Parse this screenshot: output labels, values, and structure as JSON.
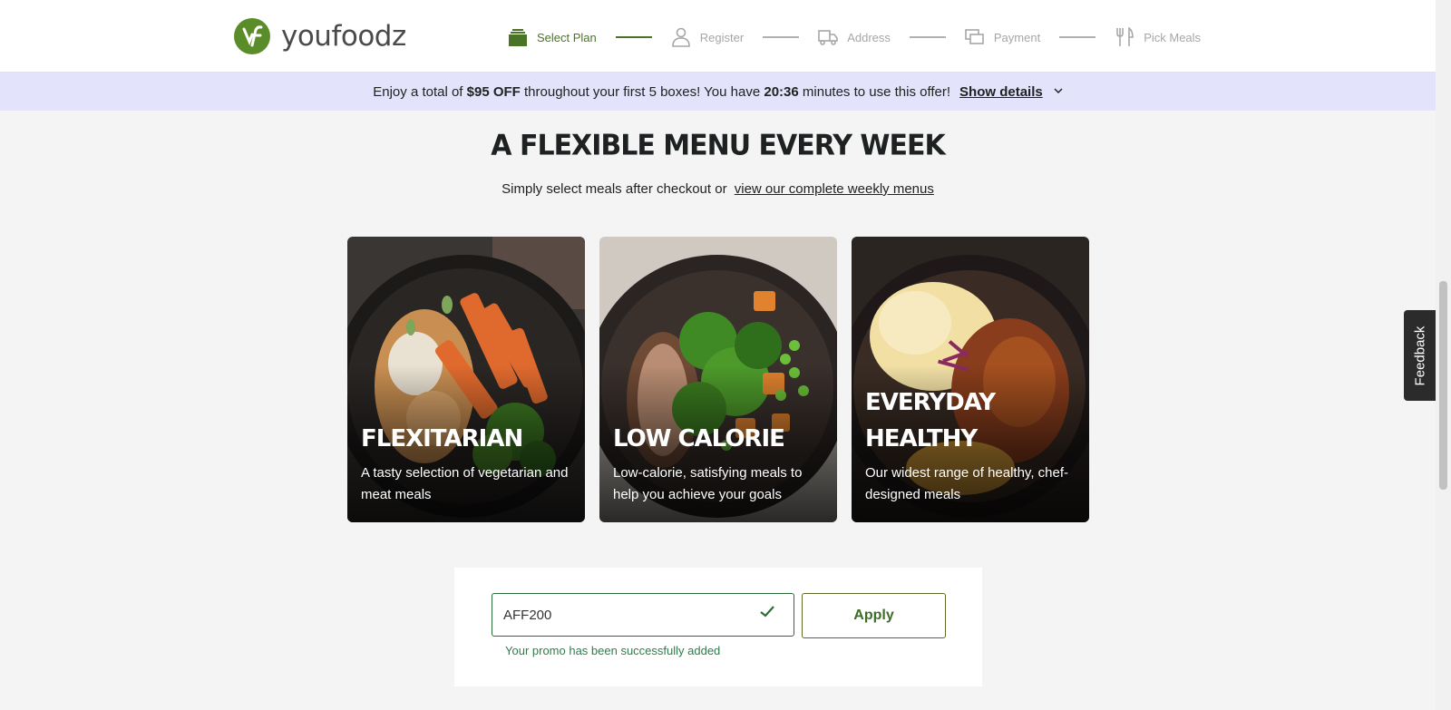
{
  "header": {
    "logo_text": "youfoodz",
    "steps": [
      {
        "label": "Select Plan",
        "icon": "box-stack-icon",
        "active": true
      },
      {
        "label": "Register",
        "icon": "person-icon",
        "active": false
      },
      {
        "label": "Address",
        "icon": "truck-icon",
        "active": false
      },
      {
        "label": "Payment",
        "icon": "card-icon",
        "active": false
      },
      {
        "label": "Pick Meals",
        "icon": "fork-knife-icon",
        "active": false
      }
    ]
  },
  "banner": {
    "text_1": "Enjoy a total of ",
    "discount": "$95 OFF",
    "text_2": " throughout your first 5 boxes! You have ",
    "timer": "20:36",
    "text_3": " minutes to use this offer!",
    "details_label": "Show details"
  },
  "menu": {
    "title": "A FLEXIBLE MENU EVERY WEEK",
    "subtitle": "Simply select meals after checkout or",
    "link_label": "view our complete weekly menus",
    "cards": [
      {
        "title": "FLEXITARIAN",
        "desc": "A tasty selection of vegetarian and meat meals"
      },
      {
        "title": "LOW CALORIE",
        "desc": "Low-calorie, satisfying meals to help you achieve your goals"
      },
      {
        "title": "EVERYDAY HEALTHY",
        "desc": "Our widest range of healthy, chef-designed meals"
      }
    ]
  },
  "promo": {
    "code_value": "AFF200",
    "apply_label": "Apply",
    "success_message": "Your promo has been successfully added"
  },
  "feedback_label": "Feedback",
  "colors": {
    "brand_green": "#4b7326",
    "banner_bg": "#e3e3fb",
    "success_green": "#2e7d4a"
  }
}
